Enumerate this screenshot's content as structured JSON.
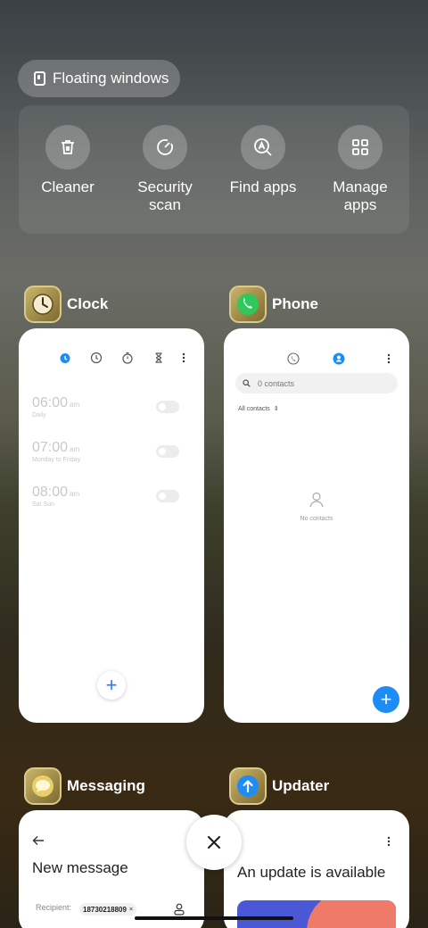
{
  "floating": {
    "label": "Floating windows"
  },
  "quick_actions": [
    {
      "label": "Cleaner",
      "icon": "trash-icon"
    },
    {
      "label": "Security\nscan",
      "icon": "security-scan-icon"
    },
    {
      "label": "Find apps",
      "icon": "find-apps-icon"
    },
    {
      "label": "Manage\napps",
      "icon": "grid-icon"
    }
  ],
  "apps": {
    "clock": {
      "name": "Clock",
      "alarms": [
        {
          "time": "06:00",
          "ampm": "am",
          "repeat": "Daily"
        },
        {
          "time": "07:00",
          "ampm": "am",
          "repeat": "Monday to Friday"
        },
        {
          "time": "08:00",
          "ampm": "am",
          "repeat": "Sat Sun"
        }
      ]
    },
    "phone": {
      "name": "Phone",
      "search_placeholder": "0 contacts",
      "filter": "All contacts",
      "empty": "No contacts"
    },
    "messaging": {
      "name": "Messaging",
      "title": "New message",
      "recipient_label": "Recipient:",
      "recipient_chip": "18730218809"
    },
    "updater": {
      "name": "Updater",
      "title": "An update is available"
    }
  },
  "colors": {
    "accent": "#1e8cf5"
  }
}
